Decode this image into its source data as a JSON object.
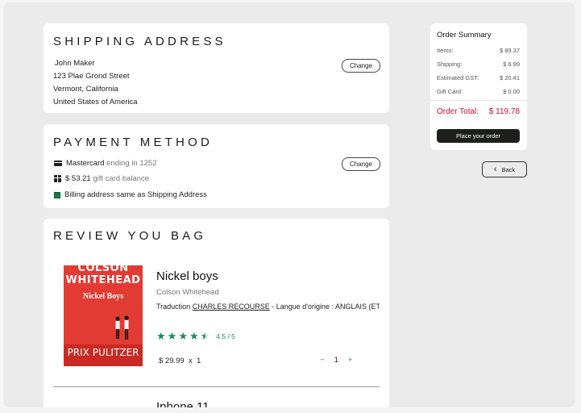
{
  "shipping": {
    "heading": "SHIPPING ADDRESS",
    "lines": [
      "John Maker",
      "123 Plae Grond Street",
      "Vermont, California",
      "United States of America"
    ],
    "change_label": "Change"
  },
  "payment": {
    "heading": "PAYMENT METHOD",
    "card_brand": "Mastercard",
    "card_suffix": "ending in 1252",
    "gift_amount": "$ 53.21",
    "gift_suffix": "gift card balance",
    "billing_text": "Billing address same as Shipping Address",
    "change_label": "Change"
  },
  "review": {
    "heading": "REVIEW YOU BAG",
    "items": [
      {
        "cover_author": "COLSON WHITEHEAD",
        "cover_title": "Nickel Boys",
        "cover_prize": "PRIX PULITZER",
        "title": "Nickel boys",
        "author": "Colson Whitehead",
        "trad_prefix": "Traduction",
        "translator": "CHARLES RECOURSE",
        "trad_suffix": "- Langue d'origine : ANGLAIS (ETATS-UNIS)",
        "rating": "4.5 / 5",
        "price": "$ 29.99",
        "times": "x",
        "qty": "1",
        "qty_minus": "−",
        "qty_plus": "+",
        "rating_value": 4.5
      },
      {
        "title": "Iphone 11"
      }
    ]
  },
  "summary": {
    "title": "Order Summary",
    "rows": [
      {
        "label": "Items:",
        "value": "$ 89.37"
      },
      {
        "label": "Shipping:",
        "value": "$ 6.99"
      },
      {
        "label": "Estimated GST:",
        "value": "$ 20.41"
      },
      {
        "label": "Gift Card:",
        "value": "$ 0.00"
      }
    ],
    "total_label": "Order Total:",
    "total_value": "$ 119.78",
    "place_label": "Place your order"
  },
  "back_label": "Back",
  "colors": {
    "accent_green": "#1a8a5a",
    "total_red": "#c8102e",
    "place_button": "#1c1f1b"
  }
}
